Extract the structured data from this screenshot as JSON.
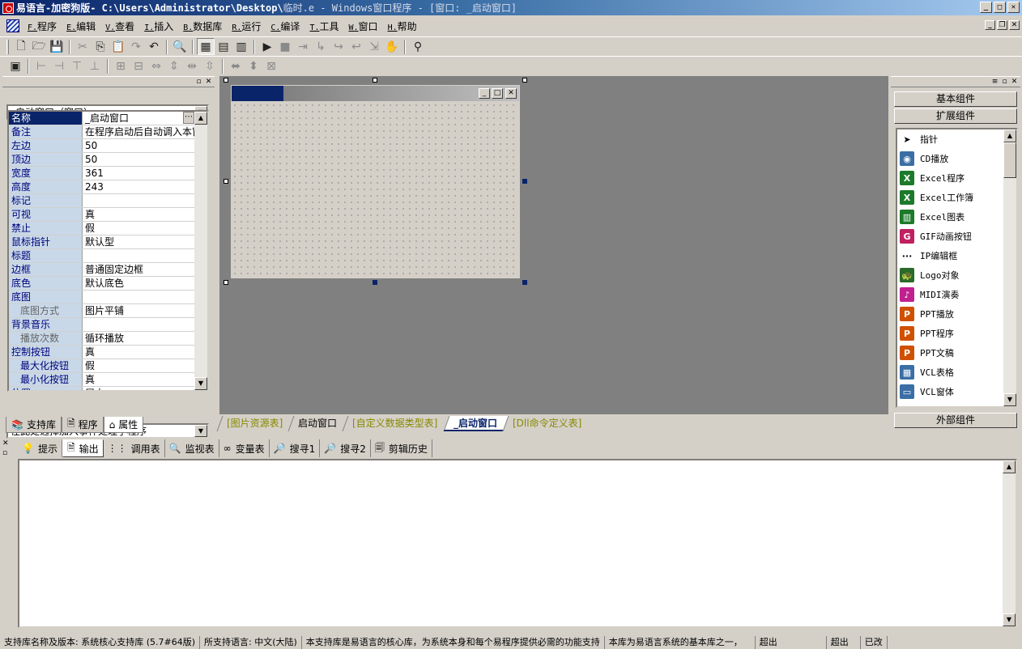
{
  "titlebar": {
    "app": "易语言-加密狗版",
    "path": " - C:\\Users\\Administrator\\Desktop\\",
    "rest": "临时.e - Windows窗口程序 - [窗口: _启动窗口]"
  },
  "menu": [
    {
      "key": "F.",
      "label": "程序"
    },
    {
      "key": "E.",
      "label": "编辑"
    },
    {
      "key": "V.",
      "label": "查看"
    },
    {
      "key": "I.",
      "label": "插入"
    },
    {
      "key": "B.",
      "label": "数据库"
    },
    {
      "key": "R.",
      "label": "运行"
    },
    {
      "key": "C.",
      "label": "编译"
    },
    {
      "key": "T.",
      "label": "工具"
    },
    {
      "key": "W.",
      "label": "窗口"
    },
    {
      "key": "H.",
      "label": "帮助"
    }
  ],
  "left": {
    "object_combo": "_启动窗口（窗口）",
    "props": [
      {
        "n": "名称",
        "v": "_启动窗口"
      },
      {
        "n": "备注",
        "v": "在程序启动后自动调入本窗"
      },
      {
        "n": "左边",
        "v": "50"
      },
      {
        "n": "顶边",
        "v": "50"
      },
      {
        "n": "宽度",
        "v": "361"
      },
      {
        "n": "高度",
        "v": "243"
      },
      {
        "n": "标记",
        "v": ""
      },
      {
        "n": "可视",
        "v": "真"
      },
      {
        "n": "禁止",
        "v": "假"
      },
      {
        "n": "鼠标指针",
        "v": "默认型"
      },
      {
        "n": "标题",
        "v": ""
      },
      {
        "n": "边框",
        "v": "普通固定边框"
      },
      {
        "n": "底色",
        "v": "默认底色"
      },
      {
        "n": "底图",
        "v": ""
      },
      {
        "n": "底图方式",
        "v": "图片平铺"
      },
      {
        "n": "背景音乐",
        "v": ""
      },
      {
        "n": "播放次数",
        "v": "循环播放"
      },
      {
        "n": "控制按钮",
        "v": "真"
      },
      {
        "n": "最大化按钮",
        "v": "假"
      },
      {
        "n": "最小化按钮",
        "v": "真"
      },
      {
        "n": "位置",
        "v": "居中"
      }
    ],
    "event_combo": "在此处选择加入事件处理子程序",
    "tabs": [
      "支持库",
      "程序",
      "属性"
    ]
  },
  "designer_tabs": [
    "[图片资源表]",
    "启动窗口",
    "[自定义数据类型表]",
    "_启动窗口",
    "[Dll命令定义表]"
  ],
  "right": {
    "basic": "基本组件",
    "extended": "扩展组件",
    "external": "外部组件",
    "components": [
      "指针",
      "CD播放",
      "Excel程序",
      "Excel工作簿",
      "Excel图表",
      "GIF动画按钮",
      "IP编辑框",
      "Logo对象",
      "MIDI演奏",
      "PPT播放",
      "PPT程序",
      "PPT文稿",
      "VCL表格",
      "VCL窗体"
    ]
  },
  "output_tabs": [
    "提示",
    "输出",
    "调用表",
    "监视表",
    "变量表",
    "搜寻1",
    "搜寻2",
    "剪辑历史"
  ],
  "status": {
    "s1": "支持库名称及版本: 系统核心支持库 (5.7#64版)",
    "s2": "所支持语言: 中文(大陆)",
    "s3": "本支持库是易语言的核心库，为系统本身和每个易程序提供必需的功能支持",
    "s4": "本库为易语言系统的基本库之一，",
    "s5": "超出",
    "s6": "超出",
    "s7": "已改"
  }
}
